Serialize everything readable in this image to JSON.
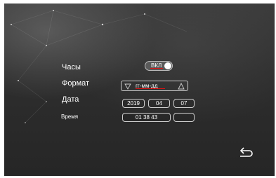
{
  "settings": {
    "clock_label": "Часы",
    "clock_toggle_text": "ВКЛ",
    "format_label": "Формат",
    "format_value": "гг-мм-дд",
    "date_label": "Дата",
    "date": {
      "year": "2019",
      "month": "04",
      "day": "07"
    },
    "time_label": "Время",
    "time": {
      "value": "01 38 43",
      "extra": ""
    }
  },
  "icons": {
    "format_prev": "triangle-down-icon",
    "format_next": "triangle-up-icon",
    "back": "return-arrow-icon"
  }
}
